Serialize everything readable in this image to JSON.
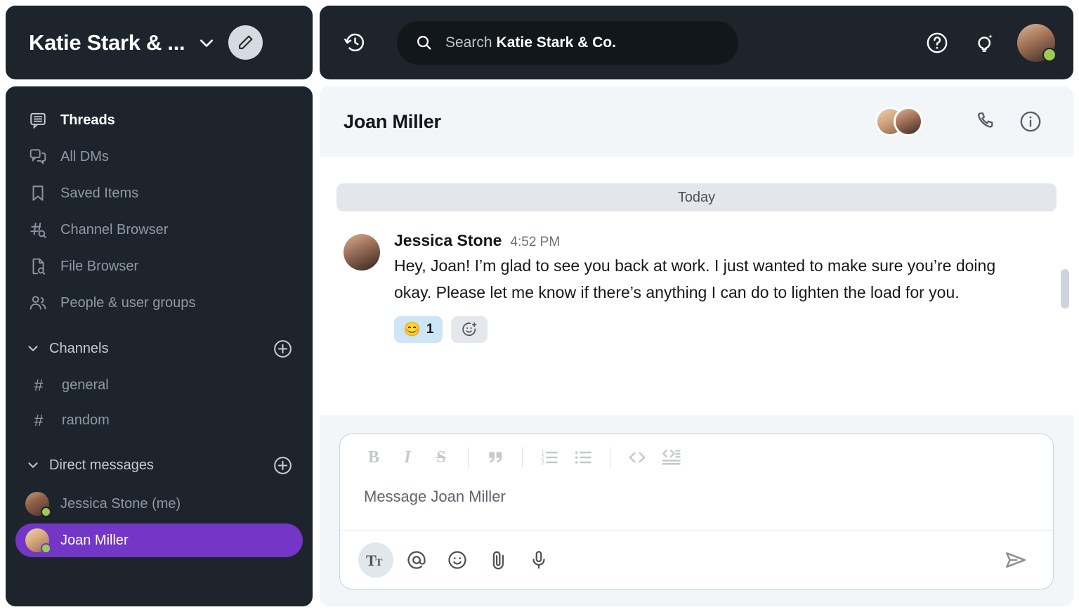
{
  "workspace": {
    "name": "Katie Stark & ...",
    "chevron_icon": "chevron-down-icon",
    "compose_icon": "pencil-icon"
  },
  "sidebar": {
    "nav": [
      {
        "label": "Threads",
        "icon": "threads-icon",
        "active": true
      },
      {
        "label": "All DMs",
        "icon": "dm-icon",
        "active": false
      },
      {
        "label": "Saved Items",
        "icon": "bookmark-icon",
        "active": false
      },
      {
        "label": "Channel Browser",
        "icon": "channel-search-icon",
        "active": false
      },
      {
        "label": "File Browser",
        "icon": "file-search-icon",
        "active": false
      },
      {
        "label": "People & user groups",
        "icon": "people-icon",
        "active": false
      }
    ],
    "channels_section": {
      "title": "Channels",
      "add_label": "+",
      "items": [
        {
          "label": "general",
          "prefix": "#"
        },
        {
          "label": "random",
          "prefix": "#"
        }
      ]
    },
    "dm_section": {
      "title": "Direct messages",
      "add_label": "+",
      "items": [
        {
          "label": "Jessica Stone (me)",
          "status": "online",
          "selected": false
        },
        {
          "label": "Joan Miller",
          "status": "online",
          "selected": true
        }
      ]
    }
  },
  "topbar": {
    "history_icon": "history-icon",
    "search": {
      "icon": "search-icon",
      "prefix": "Search",
      "scope": "Katie Stark & Co."
    },
    "help_icon": "help-circle-icon",
    "tips_icon": "lightbulb-sparkle-icon",
    "avatar_status": "online"
  },
  "conversation": {
    "title": "Joan Miller",
    "call_icon": "phone-icon",
    "info_icon": "info-circle-icon",
    "day_divider": "Today",
    "messages": [
      {
        "author": "Jessica Stone",
        "time": "4:52 PM",
        "text": "Hey, Joan! I’m glad to see you back at work. I just wanted to make sure you’re doing okay. Please let me know if there’s anything I can do to lighten the load for you.",
        "reactions": [
          {
            "emoji": "😊",
            "count": "1"
          }
        ],
        "add_reaction_icon": "add-reaction-icon"
      }
    ]
  },
  "composer": {
    "placeholder": "Message Joan Miller",
    "format_buttons": [
      {
        "name": "bold",
        "label": "B"
      },
      {
        "name": "italic",
        "label": "I"
      },
      {
        "name": "strikethrough",
        "label": "S"
      },
      {
        "name": "quote",
        "label": "❝"
      },
      {
        "name": "ordered-list",
        "label": ""
      },
      {
        "name": "bullet-list",
        "label": ""
      },
      {
        "name": "code",
        "label": "< >"
      },
      {
        "name": "code-block",
        "label": ""
      }
    ],
    "action_buttons": [
      {
        "name": "formatting",
        "icon": "text-format-icon"
      },
      {
        "name": "mention",
        "icon": "at-icon"
      },
      {
        "name": "emoji",
        "icon": "emoji-icon"
      },
      {
        "name": "attach",
        "icon": "paperclip-icon"
      },
      {
        "name": "voice",
        "icon": "microphone-icon"
      }
    ],
    "send_icon": "send-icon"
  },
  "colors": {
    "sidebar_bg": "#1d242b",
    "selected_dm": "#7336c7",
    "panel_bg": "#f2f6f9",
    "reaction_chip": "#cce6f7",
    "online": "#9ccc51"
  }
}
